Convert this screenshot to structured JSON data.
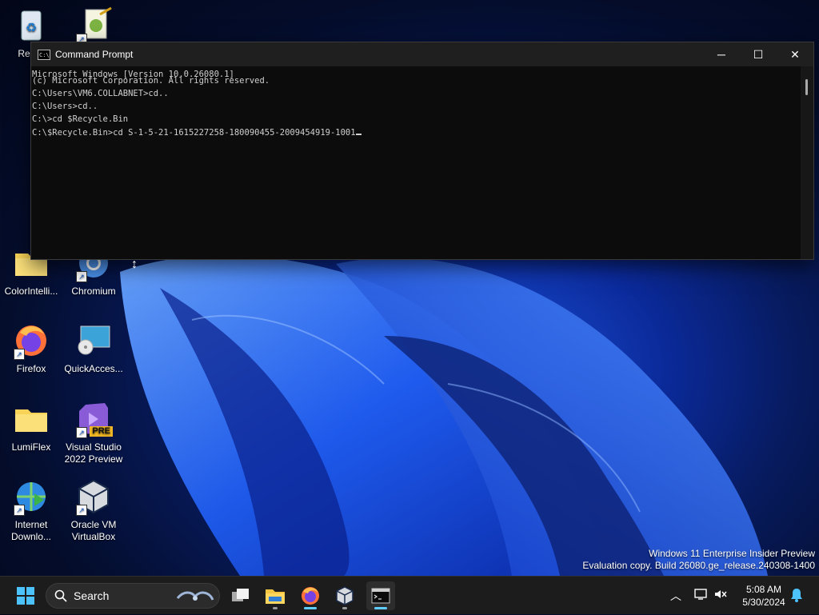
{
  "desktop": {
    "icons": {
      "recycle": "Recyc",
      "colorintelli": "ColorIntelli...",
      "chromium": "Chromium",
      "firefox": "Firefox",
      "quickaccess": "QuickAcces...",
      "lumiflex": "LumiFlex",
      "vs_line1": "Visual Studio",
      "vs_line2": "2022 Preview",
      "vs_badge": "PRE",
      "idm_line1": "Internet",
      "idm_line2": "Downlo...",
      "vbox_line1": "Oracle VM",
      "vbox_line2": "VirtualBox"
    },
    "watermark": {
      "line1": "Windows 11 Enterprise Insider Preview",
      "line2": "Evaluation copy. Build 26080.ge_release.240308-1400"
    }
  },
  "cmd": {
    "title": "Command Prompt",
    "lines": [
      "Microsoft Windows [Version 10.0.26080.1]",
      "(c) Microsoft Corporation. All rights reserved.",
      "C:\\Users\\VM6.COLLABNET>cd..",
      "C:\\Users>cd..",
      "C:\\>cd $Recycle.Bin",
      "C:\\$Recycle.Bin>cd S-1-5-21-1615227258-180090455-2009454919-1001"
    ]
  },
  "taskbar": {
    "search_placeholder": "Search",
    "time": "5:08 AM",
    "date": "5/30/2024"
  },
  "colors": {
    "accent": "#60cdff",
    "taskbar_bg": "#1c1c1c",
    "console_bg": "#0c0c0c"
  }
}
